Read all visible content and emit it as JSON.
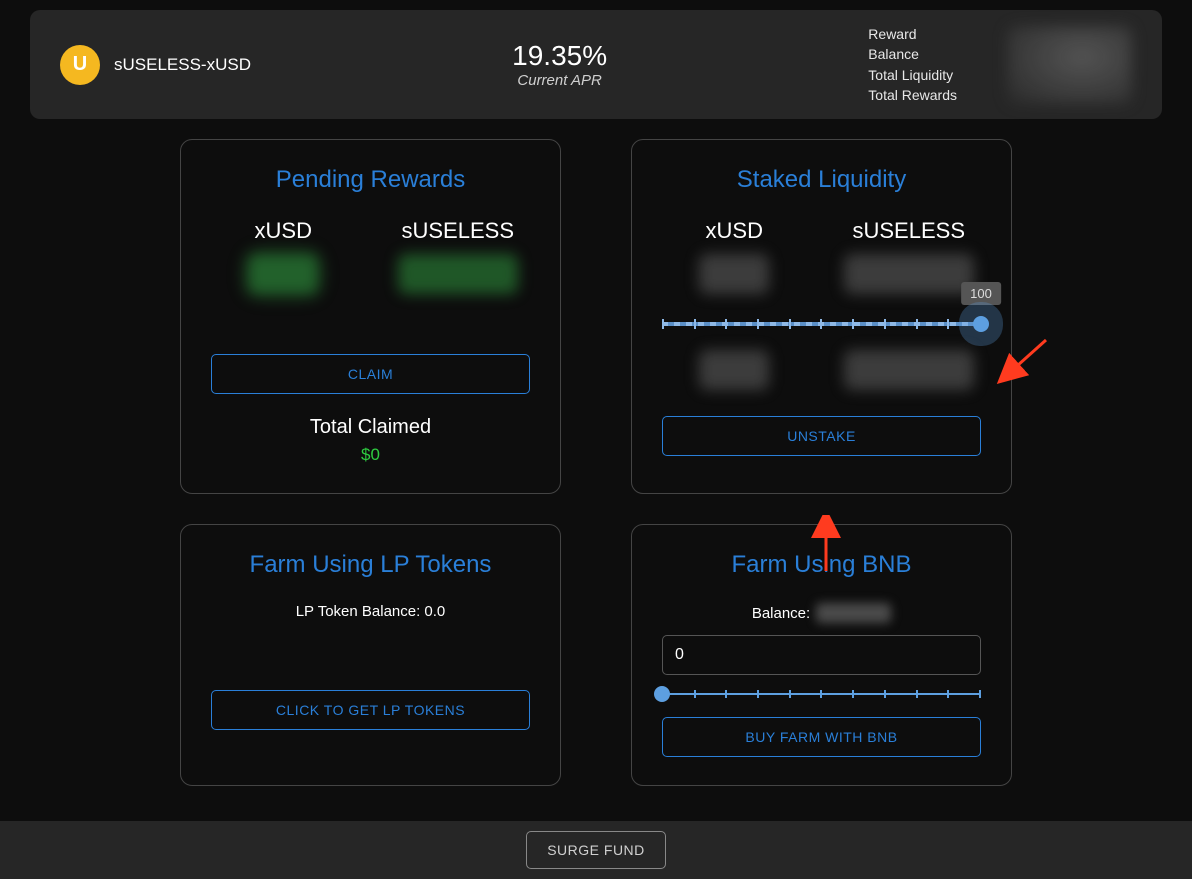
{
  "header": {
    "token_icon_letter": "U",
    "token_name": "sUSELESS-xUSD",
    "apr_value": "19.35%",
    "apr_label": "Current APR",
    "stats": {
      "reward": "Reward",
      "balance": "Balance",
      "total_liquidity": "Total Liquidity",
      "total_rewards": "Total Rewards"
    }
  },
  "pending_rewards": {
    "title": "Pending Rewards",
    "col1": "xUSD",
    "col2": "sUSELESS",
    "claim_btn": "CLAIM",
    "total_claimed_label": "Total Claimed",
    "total_claimed_value": "$0"
  },
  "staked_liquidity": {
    "title": "Staked Liquidity",
    "col1": "xUSD",
    "col2": "sUSELESS",
    "slider_value": "100",
    "unstake_btn": "UNSTAKE"
  },
  "farm_lp": {
    "title": "Farm Using LP Tokens",
    "balance_text": "LP Token Balance: 0.0",
    "get_lp_btn": "CLICK TO GET LP TOKENS"
  },
  "farm_bnb": {
    "title": "Farm Using BNB",
    "balance_label": "Balance:",
    "input_value": "0",
    "buy_btn": "BUY FARM WITH BNB"
  },
  "footer": {
    "surge_btn": "SURGE FUND"
  }
}
